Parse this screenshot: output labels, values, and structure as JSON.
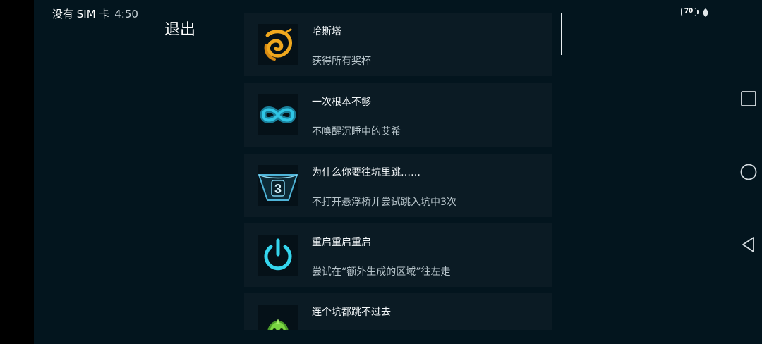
{
  "status_bar": {
    "carrier": "没有 SIM 卡",
    "time": "4:50",
    "battery_level": "70"
  },
  "header": {
    "exit_label": "退出"
  },
  "achievements": [
    {
      "title": "哈斯塔",
      "description": "获得所有奖杯",
      "icon": "hastur-sigil-icon",
      "color": "#f0a81e"
    },
    {
      "title": "一次根本不够",
      "description": "不唤醒沉睡中的艾希",
      "icon": "infinity-icon",
      "color": "#2fc6e6"
    },
    {
      "title": "为什么你要往坑里跳……",
      "description": "不打开悬浮桥并尝试跳入坑中3次",
      "icon": "pit-3-icon",
      "badge": "3",
      "color": "#4fb4d8"
    },
    {
      "title": "重启重启重启",
      "description": "尝试在“额外生成的区域”往左走",
      "icon": "power-icon",
      "color": "#35d6ee"
    },
    {
      "title": "连个坑都跳不过去",
      "description": "",
      "icon": "green-skull-icon",
      "color": "#66c83a"
    }
  ],
  "nav_bar": {
    "buttons": [
      "recent-apps",
      "home",
      "back"
    ]
  }
}
